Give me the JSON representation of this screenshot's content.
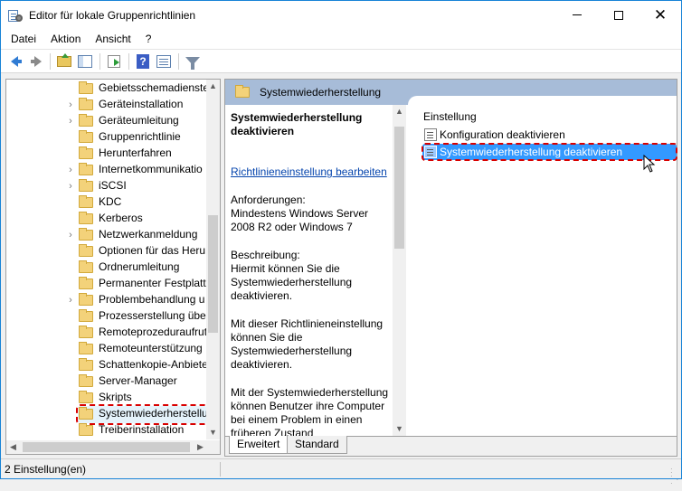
{
  "window": {
    "title": "Editor für lokale Gruppenrichtlinien",
    "minimize_icon": "minimize-icon",
    "maximize_icon": "maximize-icon",
    "close_symbol": "✕"
  },
  "menu": [
    "Datei",
    "Aktion",
    "Ansicht",
    "?"
  ],
  "toolbar": {
    "icons": [
      "back-arrow-icon",
      "forward-arrow-icon",
      "folder-up-icon",
      "show-hide-tree-icon",
      "export-list-icon",
      "help-icon",
      "properties-icon",
      "filter-icon"
    ],
    "help_glyph": "?"
  },
  "tree": {
    "items": [
      {
        "label": "Gebietsschemadienste",
        "expandable": false
      },
      {
        "label": "Geräteinstallation",
        "expandable": true
      },
      {
        "label": "Geräteumleitung",
        "expandable": true
      },
      {
        "label": "Gruppenrichtlinie",
        "expandable": false
      },
      {
        "label": "Herunterfahren",
        "expandable": false
      },
      {
        "label": "Internetkommunikatio",
        "expandable": true
      },
      {
        "label": "iSCSI",
        "expandable": true
      },
      {
        "label": "KDC",
        "expandable": false
      },
      {
        "label": "Kerberos",
        "expandable": false
      },
      {
        "label": "Netzwerkanmeldung",
        "expandable": true
      },
      {
        "label": "Optionen für das Heru",
        "expandable": false
      },
      {
        "label": "Ordnerumleitung",
        "expandable": false
      },
      {
        "label": "Permanenter Festplatt",
        "expandable": false
      },
      {
        "label": "Problembehandlung u",
        "expandable": true
      },
      {
        "label": "Prozesserstellung über",
        "expandable": false
      },
      {
        "label": "Remoteprozeduraufrut",
        "expandable": false
      },
      {
        "label": "Remoteunterstützung",
        "expandable": false
      },
      {
        "label": "Schattenkopie-Anbiete",
        "expandable": false
      },
      {
        "label": "Server-Manager",
        "expandable": false
      },
      {
        "label": "Skripts",
        "expandable": false
      },
      {
        "label": "Systemwiederherstellu",
        "expandable": false,
        "selected": true
      },
      {
        "label": "Treiberinstallation",
        "expandable": false
      }
    ],
    "expander_glyph": "›"
  },
  "right": {
    "header_title": "Systemwiederherstellung",
    "description": {
      "title": "Systemwiederherstellung deaktivieren",
      "link": "Richtlinieneinstellung bearbeiten",
      "requirements_label": "Anforderungen:",
      "requirements_text": "Mindestens Windows Server 2008 R2 oder Windows 7",
      "description_label": "Beschreibung:",
      "description_text": "Hiermit können Sie die Systemwiederherstellung deaktivieren.",
      "paragraph_2": "Mit dieser Richtlinieneinstellung können Sie die Systemwiederherstellung deaktivieren.",
      "paragraph_3": "Mit der Systemwiederherstellung können Benutzer ihre Computer bei einem Problem in einen früheren Zustand zurückversetzen, ohne dass persönliche"
    },
    "settings_header": "Einstellung",
    "settings": [
      {
        "label": "Konfiguration deaktivieren",
        "selected": false
      },
      {
        "label": "Systemwiederherstellung deaktivieren",
        "selected": true
      }
    ],
    "tabs": [
      "Erweitert",
      "Standard"
    ]
  },
  "status": {
    "text": "2 Einstellung(en)"
  },
  "colors": {
    "accent": "#1883d7",
    "header_bg": "#a7bcd8",
    "selection": "#3399ff",
    "highlight_dash": "#d90000",
    "link": "#0645ad"
  }
}
